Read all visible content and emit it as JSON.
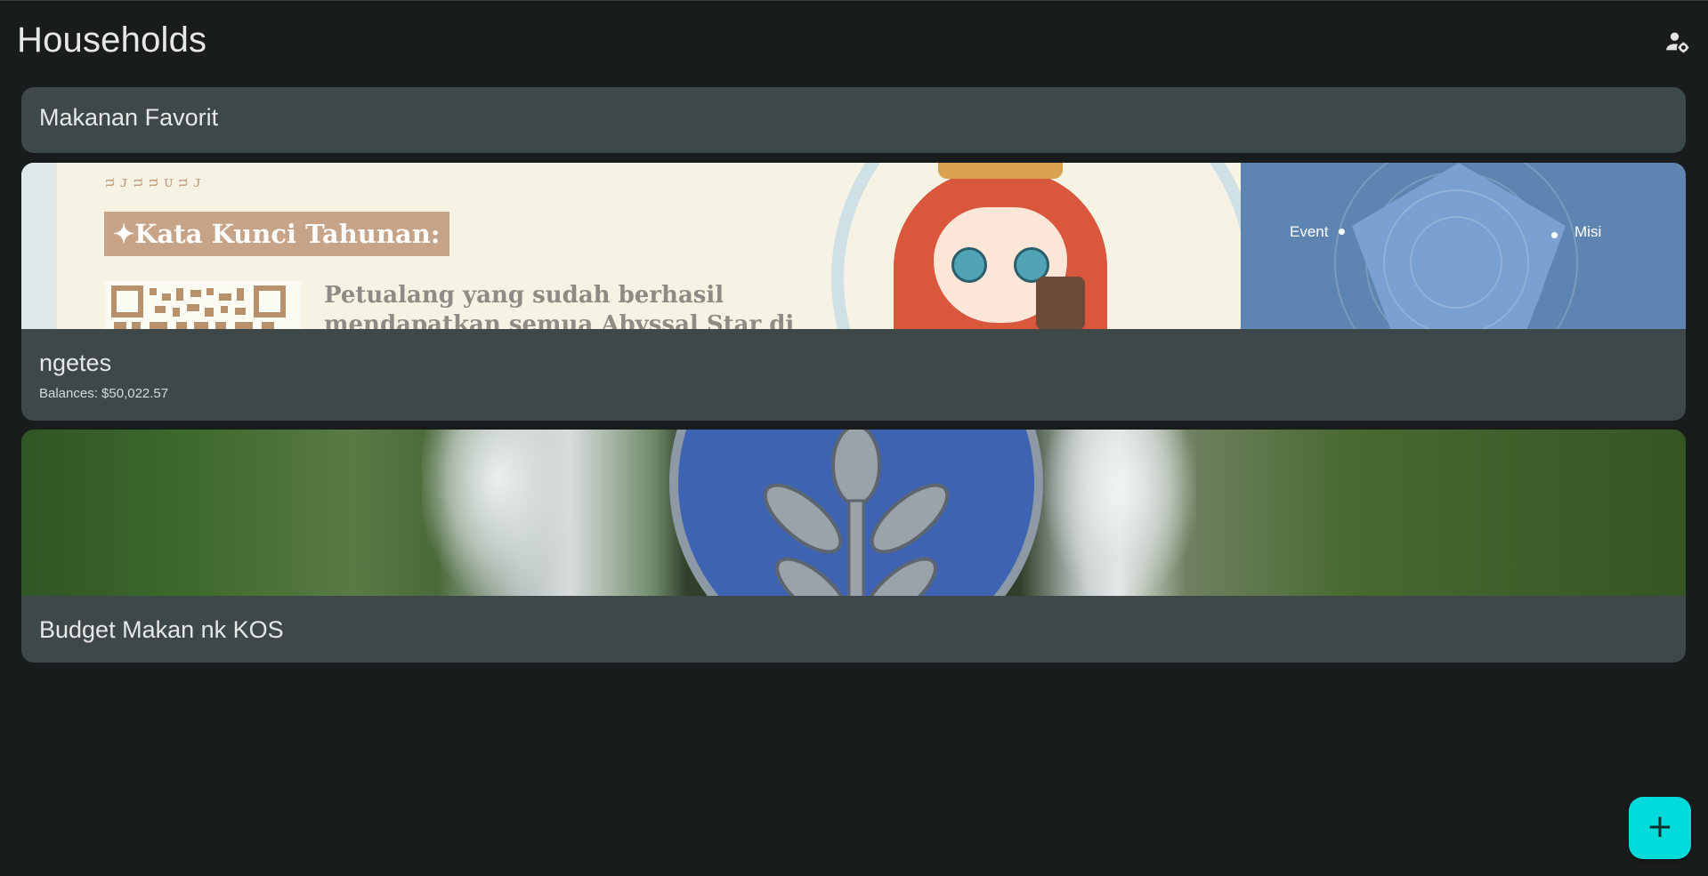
{
  "header": {
    "title": "Households",
    "manage_icon": "manage-accounts-icon"
  },
  "households": [
    {
      "name": "Makanan Favorit"
    },
    {
      "name": "ngetes",
      "subtitle": "Balances: $50,022.57",
      "banner": {
        "runes": "ᴝᴊᴝᴝᴜᴝᴊ",
        "keyword": "✦Kata Kunci Tahunan:",
        "promo_line1": "Petualang yang sudah berhasil",
        "promo_line2": "mendapatkan semua Abyssal Star di",
        "radar_left": "Event",
        "radar_right": "Misi"
      }
    },
    {
      "name": "Budget Makan nk KOS"
    }
  ],
  "fab": {
    "label": "+",
    "icon": "add-icon"
  },
  "colors": {
    "background": "#191c1d",
    "card": "#3f4849",
    "accent": "#00dada"
  }
}
